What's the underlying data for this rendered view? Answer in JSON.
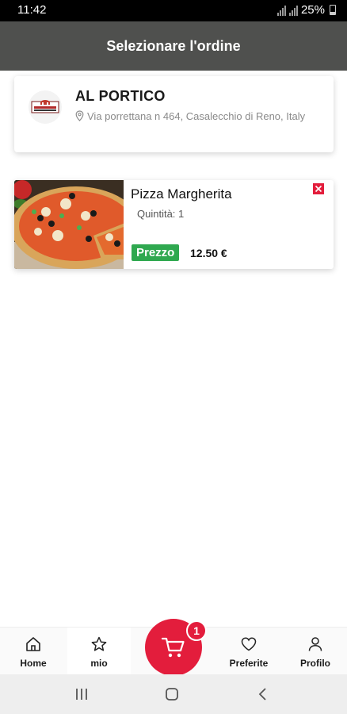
{
  "status_bar": {
    "time": "11:42",
    "battery": "25%"
  },
  "header": {
    "title": "Selezionare l'ordine"
  },
  "restaurant": {
    "name": "AL PORTICO",
    "address": "Via porrettana n 464, Casalecchio di Reno, Italy"
  },
  "order_items": [
    {
      "name": "Pizza Margherita",
      "quantity": "Quintità: 1",
      "price_label": "Prezzo",
      "price": "12.50 €"
    }
  ],
  "bottom_nav": {
    "home": "Home",
    "mio": "mio",
    "preferite": "Preferite",
    "profilo": "Profilo",
    "cart_count": "1"
  },
  "colors": {
    "header_bg": "#4f504e",
    "accent_red": "#e31d3c",
    "price_green": "#2fa84f"
  },
  "icons": [
    "home-icon",
    "star-icon",
    "cart-icon",
    "heart-icon",
    "person-icon",
    "pin-icon",
    "close-icon"
  ]
}
